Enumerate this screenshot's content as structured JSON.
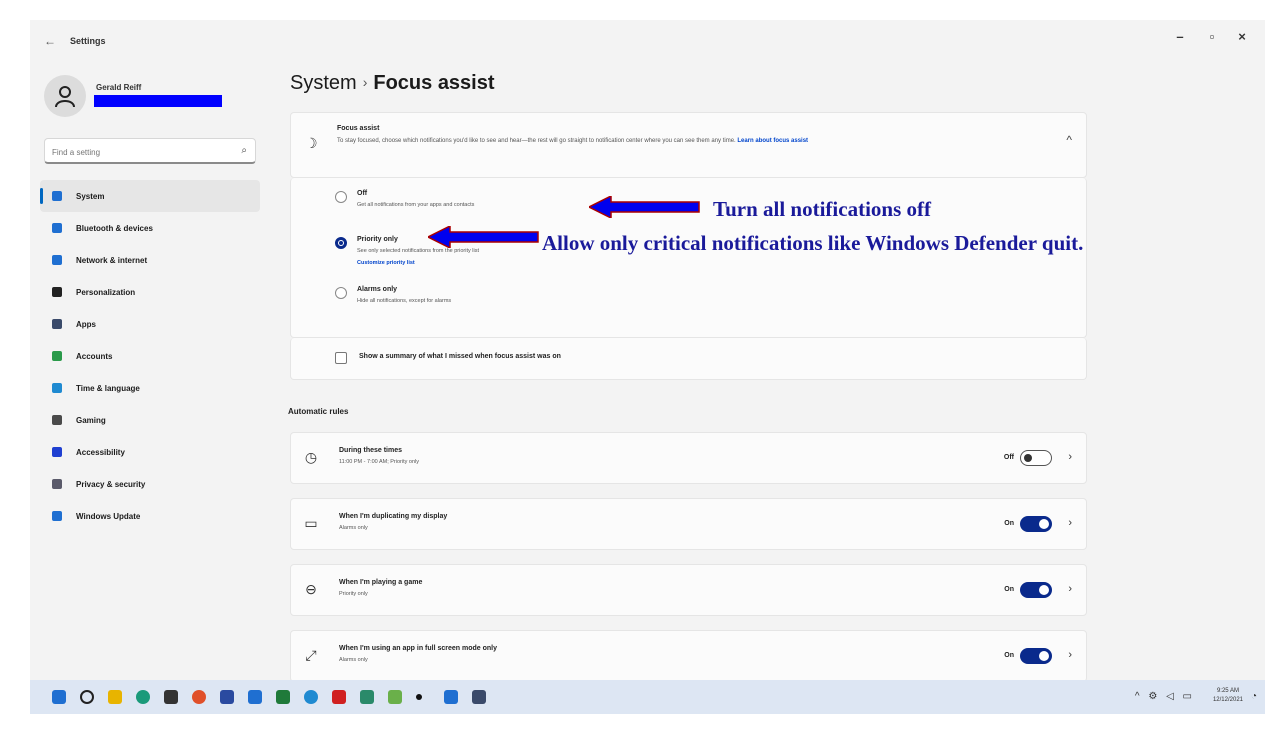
{
  "window": {
    "app_title": "Settings",
    "controls": {
      "minimize": "–",
      "maximize": "▫",
      "close": "×"
    }
  },
  "profile": {
    "name": "Gerald Reiff"
  },
  "search": {
    "placeholder": "Find a setting"
  },
  "sidebar": {
    "items": [
      {
        "label": "System",
        "icon": "system-icon",
        "color": "#1f6fd1",
        "selected": true
      },
      {
        "label": "Bluetooth & devices",
        "icon": "bluetooth-icon",
        "color": "#1f6fd1"
      },
      {
        "label": "Network & internet",
        "icon": "network-icon",
        "color": "#1f6fd1"
      },
      {
        "label": "Personalization",
        "icon": "brush-icon",
        "color": "#222222"
      },
      {
        "label": "Apps",
        "icon": "apps-icon",
        "color": "#3a4a6a"
      },
      {
        "label": "Accounts",
        "icon": "accounts-icon",
        "color": "#2a9a4a"
      },
      {
        "label": "Time & language",
        "icon": "globe-icon",
        "color": "#1f8ad1"
      },
      {
        "label": "Gaming",
        "icon": "gaming-icon",
        "color": "#4a4a4a"
      },
      {
        "label": "Accessibility",
        "icon": "accessibility-icon",
        "color": "#1f3fd1"
      },
      {
        "label": "Privacy & security",
        "icon": "shield-icon",
        "color": "#5a5a6a"
      },
      {
        "label": "Windows Update",
        "icon": "update-icon",
        "color": "#1f6fd1"
      }
    ]
  },
  "breadcrumb": {
    "parent": "System",
    "separator": "›",
    "current": "Focus assist"
  },
  "focus_assist": {
    "title": "Focus assist",
    "description": "To stay focused, choose which notifications you'd like to see and hear—the rest will go straight to notification center where you can see them any time.",
    "learn_more": "Learn about focus assist",
    "options": [
      {
        "label": "Off",
        "description": "Get all notifications from your apps and contacts",
        "selected": false
      },
      {
        "label": "Priority only",
        "description": "See only selected notifications from the priority list",
        "link": "Customize priority list",
        "selected": true
      },
      {
        "label": "Alarms only",
        "description": "Hide all notifications, except for alarms",
        "selected": false
      }
    ],
    "summary_checkbox": "Show a summary of what I missed when focus assist was on"
  },
  "automatic_rules": {
    "title": "Automatic rules",
    "rules": [
      {
        "title": "During these times",
        "subtitle": "11:00 PM - 7:00 AM; Priority only",
        "state": "Off",
        "on": false,
        "icon": "clock-icon"
      },
      {
        "title": "When I'm duplicating my display",
        "subtitle": "Alarms only",
        "state": "On",
        "on": true,
        "icon": "display-icon"
      },
      {
        "title": "When I'm playing a game",
        "subtitle": "Priority only",
        "state": "On",
        "on": true,
        "icon": "game-controller-icon"
      },
      {
        "title": "When I'm using an app in full screen mode only",
        "subtitle": "Alarms only",
        "state": "On",
        "on": true,
        "icon": "fullscreen-icon"
      }
    ]
  },
  "annotations": {
    "off_note": "Turn all notifications off",
    "priority_note": "Allow only critical notifications like Windows Defender quit.",
    "arrow_color": "#0000ee"
  },
  "taskbar": {
    "tray": "^ ⚙ ◁ ▭",
    "time": "9:25 AM",
    "date": "12/12/2021"
  }
}
